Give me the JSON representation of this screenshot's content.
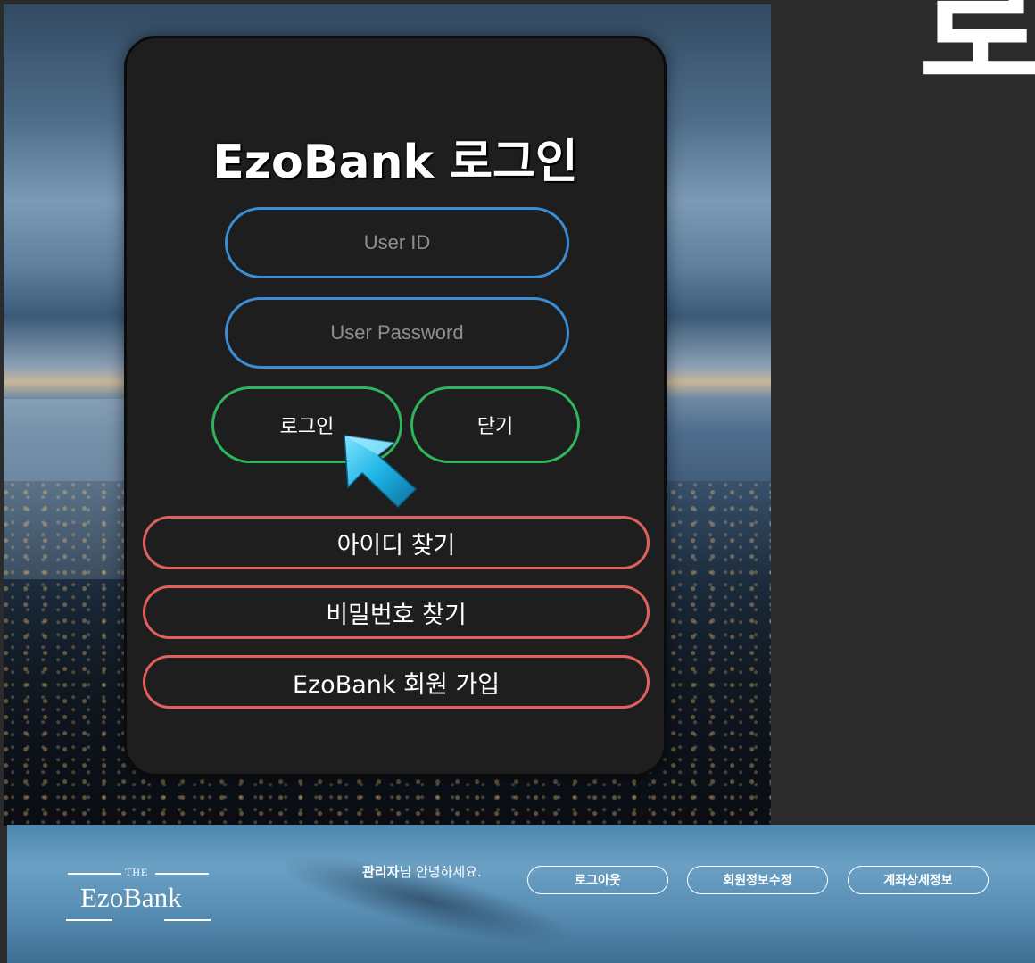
{
  "background": {
    "cropped_heading": "로"
  },
  "login": {
    "title": "EzoBank 로그인",
    "user_id_placeholder": "User ID",
    "password_placeholder": "User Password",
    "login_button": "로그인",
    "close_button": "닫기",
    "find_id_button": "아이디 찾기",
    "find_password_button": "비밀번호 찾기",
    "signup_button": "EzoBank 회원 가입"
  },
  "header": {
    "logo_the": "THE",
    "logo_brand": "EzoBank",
    "greeting_name": "관리자",
    "greeting_suffix": "님 안녕하세요.",
    "logout_button": "로그아웃",
    "edit_profile_button": "회원정보수정",
    "account_details_button": "계좌상세정보"
  },
  "colors": {
    "input_border": "#3b8ed6",
    "primary_button_border": "#2fb55c",
    "secondary_button_border": "#e2605c",
    "card_background": "#1e1e1e"
  },
  "icons": {
    "cursor": "cursor-arrow-icon"
  }
}
